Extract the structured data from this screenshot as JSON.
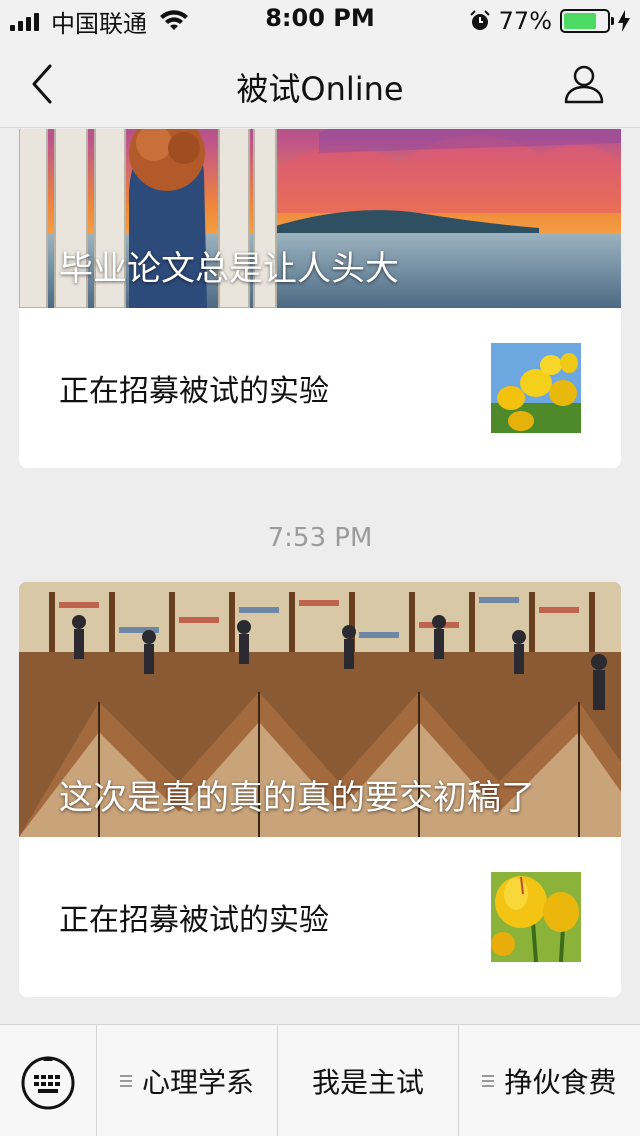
{
  "status_bar": {
    "carrier": "中国联通",
    "time": "8:00 PM",
    "battery": "77%",
    "battery_level": 0.77
  },
  "nav": {
    "title": "被试Online"
  },
  "cards": [
    {
      "hero_title": "毕业论文总是让人头大",
      "row_label": "正在招募被试的实验"
    },
    {
      "hero_title": "这次是真的真的真的要交初稿了",
      "row_label": "正在招募被试的实验"
    }
  ],
  "timestamp": "7:53 PM",
  "bottom_menu": {
    "items": [
      "心理学系",
      "我是主试",
      "挣伙食费"
    ]
  },
  "colors": {
    "battery_fill": "#4cd964",
    "background": "#ededed"
  }
}
